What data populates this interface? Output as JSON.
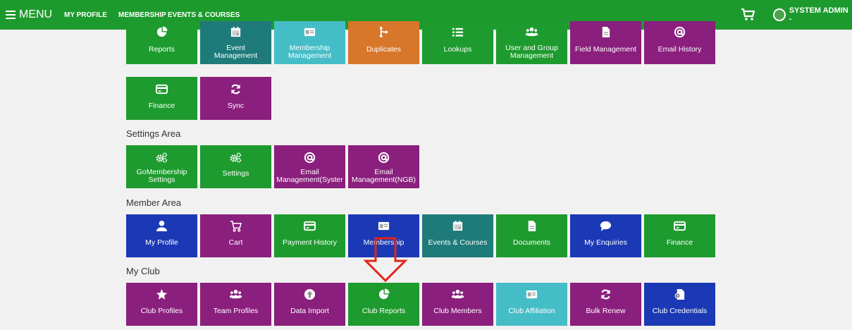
{
  "topbar": {
    "menu_label": "MENU",
    "nav": [
      {
        "label": "MY PROFILE"
      },
      {
        "label": "MEMBERSHIP"
      },
      {
        "label": "EVENTS & COURSES"
      }
    ],
    "user_label": "SYSTEM ADMIN -",
    "bar_color": "#1d9a2d"
  },
  "admin_tiles_row1": [
    {
      "label": "Reports",
      "icon": "pie-chart-icon",
      "color": "#1e9b2e"
    },
    {
      "label": "Event\nManagement",
      "icon": "calendar-icon",
      "color": "#1f7a7a"
    },
    {
      "label": "Membership\nManagement",
      "icon": "id-card-icon",
      "color": "#45bdc7"
    },
    {
      "label": "Duplicates",
      "icon": "merge-icon",
      "color": "#d8762a"
    },
    {
      "label": "Lookups",
      "icon": "list-icon",
      "color": "#1e9b2e"
    },
    {
      "label": "User and Group\nManagement",
      "icon": "users-icon",
      "color": "#1e9b2e"
    },
    {
      "label": "Field Management",
      "icon": "file-icon",
      "color": "#8a1f7d"
    },
    {
      "label": "Email History",
      "icon": "at-icon",
      "color": "#8a1f7d"
    }
  ],
  "admin_tiles_row2": [
    {
      "label": "Finance",
      "icon": "card-icon",
      "color": "#1e9b2e"
    },
    {
      "label": "Sync",
      "icon": "sync-icon",
      "color": "#8a1f7d"
    }
  ],
  "settings_title": "Settings Area",
  "settings_tiles": [
    {
      "label": "GoMembership\nSettings",
      "icon": "cogs-icon",
      "color": "#1e9b2e"
    },
    {
      "label": "Settings",
      "icon": "cogs-icon",
      "color": "#1e9b2e"
    },
    {
      "label": "Email\nManagement(Syster",
      "icon": "at-icon",
      "color": "#8a1f7d"
    },
    {
      "label": "Email\nManagement(NGB)",
      "icon": "at-icon",
      "color": "#8a1f7d"
    }
  ],
  "member_title": "Member Area",
  "member_tiles": [
    {
      "label": "My Profile",
      "icon": "user-icon",
      "color": "#1b39b5"
    },
    {
      "label": "Cart",
      "icon": "cart-icon",
      "color": "#8a1f7d"
    },
    {
      "label": "Payment History",
      "icon": "card-icon",
      "color": "#1e9b2e"
    },
    {
      "label": "Membership",
      "icon": "id-card-icon",
      "color": "#1b39b5"
    },
    {
      "label": "Events & Courses",
      "icon": "calendar-icon",
      "color": "#1f7a7a"
    },
    {
      "label": "Documents",
      "icon": "file-icon",
      "color": "#1e9b2e"
    },
    {
      "label": "My Enquiries",
      "icon": "chat-icon",
      "color": "#1b39b5"
    },
    {
      "label": "Finance",
      "icon": "card-icon",
      "color": "#1e9b2e"
    }
  ],
  "club_title": "My Club",
  "club_tiles": [
    {
      "label": "Club Profiles",
      "icon": "star-icon",
      "color": "#8a1f7d"
    },
    {
      "label": "Team Profiles",
      "icon": "users-icon",
      "color": "#8a1f7d"
    },
    {
      "label": "Data Import",
      "icon": "upload-icon",
      "color": "#8a1f7d"
    },
    {
      "label": "Club Reports",
      "icon": "pie-chart-icon",
      "color": "#1e9b2e"
    },
    {
      "label": "Club Members",
      "icon": "users-icon",
      "color": "#8a1f7d"
    },
    {
      "label": "Club Affiliation",
      "icon": "id-card-icon",
      "color": "#45bdc7"
    },
    {
      "label": "Bulk Renew",
      "icon": "sync-icon",
      "color": "#8a1f7d"
    },
    {
      "label": "Club Credentials",
      "icon": "key-file-icon",
      "color": "#1b39b5"
    }
  ],
  "annotation": {
    "arrow_color": "#e0251b",
    "points_to": "Club Reports"
  }
}
